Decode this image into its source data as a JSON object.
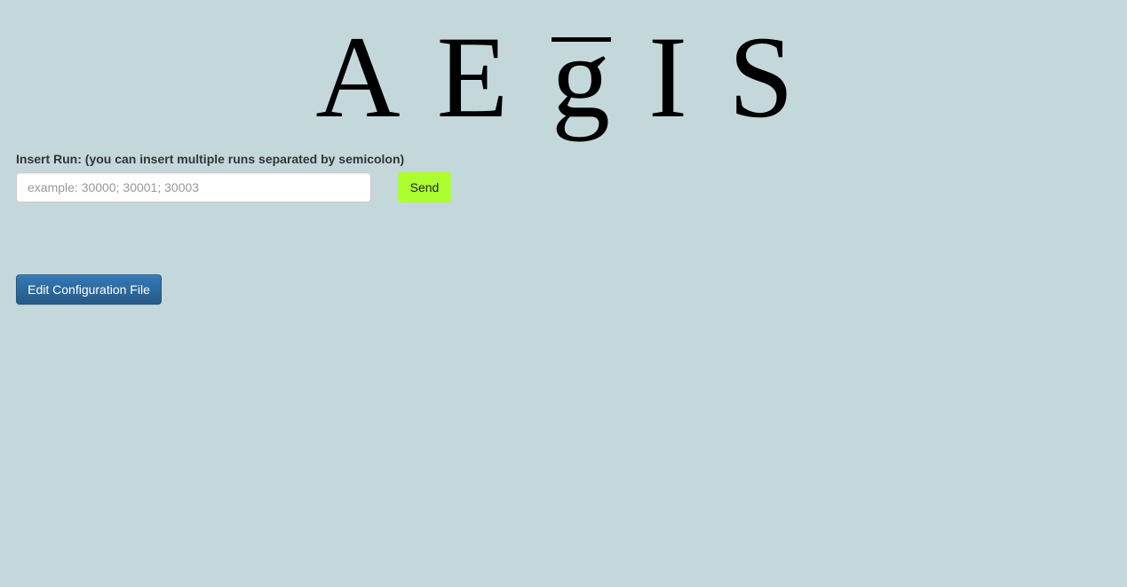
{
  "logo": {
    "letters": [
      "A",
      "E",
      "g",
      "I",
      "S"
    ]
  },
  "run_form": {
    "label": "Insert Run: (you can insert multiple runs separated by semicolon)",
    "input_placeholder": "example: 30000; 30001; 30003",
    "input_value": "",
    "send_label": "Send"
  },
  "config": {
    "edit_label": "Edit Configuration File"
  },
  "colors": {
    "background": "#c4d8db",
    "send_button": "#adff2f",
    "config_button": "#337ab7"
  }
}
